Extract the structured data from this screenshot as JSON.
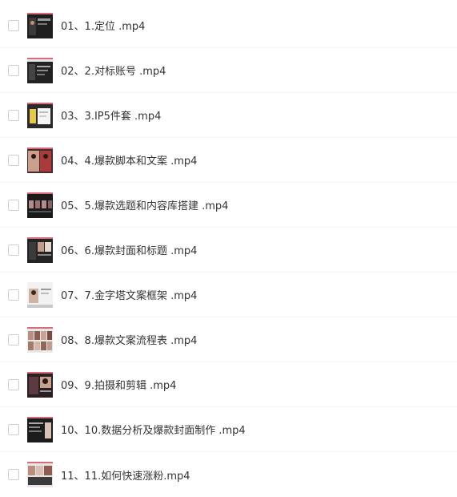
{
  "files": [
    {
      "name": "01、1.定位 .mp4",
      "thumb": "dark-ui"
    },
    {
      "name": "02、2.对标账号 .mp4",
      "thumb": "dark-ui"
    },
    {
      "name": "03、3.IP5件套 .mp4",
      "thumb": "yellow-white"
    },
    {
      "name": "04、4.爆款脚本和文案 .mp4",
      "thumb": "portraits"
    },
    {
      "name": "05、5.爆款选题和内容库搭建 .mp4",
      "thumb": "dark-ui"
    },
    {
      "name": "06、6.爆款封面和标题 .mp4",
      "thumb": "dark-portraits"
    },
    {
      "name": "07、7.金字塔文案框架 .mp4",
      "thumb": "white-portrait"
    },
    {
      "name": "08、8.爆款文案流程表 .mp4",
      "thumb": "grid-portraits"
    },
    {
      "name": "09、9.拍摄和剪辑 .mp4",
      "thumb": "dark-portraits"
    },
    {
      "name": "10、10.数据分析及爆款封面制作 .mp4",
      "thumb": "dark-ui"
    },
    {
      "name": "11、11.如何快速涨粉.mp4",
      "thumb": "grid-portraits"
    }
  ]
}
